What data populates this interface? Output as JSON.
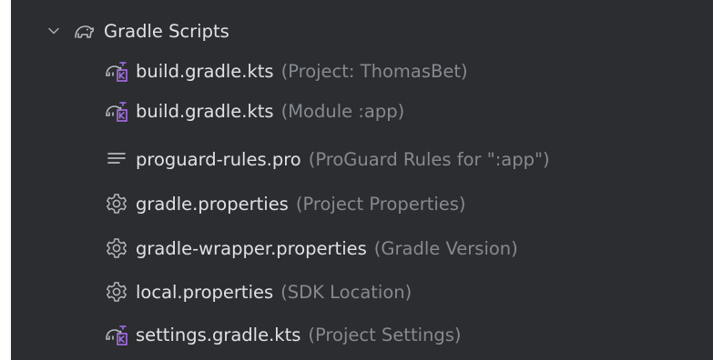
{
  "tree": {
    "root": {
      "label": "Gradle Scripts",
      "icon": "gradle-elephant-icon",
      "expanded": true
    },
    "items": [
      {
        "name": "build.gradle.kts",
        "hint": "(Project: ThomasBet)",
        "icon": "gradle-kotlin-script-icon"
      },
      {
        "name": "build.gradle.kts",
        "hint": "(Module :app)",
        "icon": "gradle-kotlin-script-icon"
      },
      {
        "name": "proguard-rules.pro",
        "hint": "(ProGuard Rules for \":app\")",
        "icon": "text-file-icon"
      },
      {
        "name": "gradle.properties",
        "hint": "(Project Properties)",
        "icon": "properties-gear-icon"
      },
      {
        "name": "gradle-wrapper.properties",
        "hint": "(Gradle Version)",
        "icon": "properties-gear-icon"
      },
      {
        "name": "local.properties",
        "hint": "(SDK Location)",
        "icon": "properties-gear-icon"
      },
      {
        "name": "settings.gradle.kts",
        "hint": "(Project Settings)",
        "icon": "gradle-kotlin-script-icon"
      }
    ]
  },
  "colors": {
    "background": "#2b2d30",
    "text": "#dfe1e5",
    "hint": "#868a91",
    "kotlin_accent": "#a86ee8"
  }
}
